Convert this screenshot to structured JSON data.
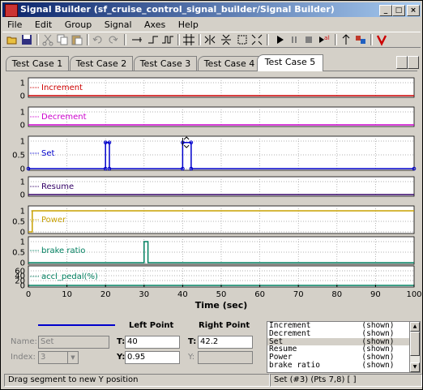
{
  "window": {
    "title": "Signal Builder (sf_cruise_control_signal_builder/Signal Builder)",
    "minimize": "_",
    "maximize": "□",
    "close": "×"
  },
  "menu": [
    "File",
    "Edit",
    "Group",
    "Signal",
    "Axes",
    "Help"
  ],
  "toolbar_icons": [
    "open-icon",
    "save-icon",
    "cut-icon",
    "copy-icon",
    "paste-icon",
    "undo-icon",
    "redo-icon",
    "step-right-icon",
    "step-up-icon",
    "pulse-icon",
    "grid-icon",
    "zoom-x-icon",
    "zoom-y-icon",
    "zoom-box-icon",
    "fit-icon",
    "play-icon",
    "pause-icon",
    "stop-icon",
    "record-icon",
    "toggle-icon",
    "simulink-icon",
    "verify-icon"
  ],
  "tabs": [
    "Test Case 1",
    "Test Case 2",
    "Test Case 3",
    "Test Case 4",
    "Test Case 5"
  ],
  "active_tab": "Test Case 5",
  "chart_data": {
    "type": "line",
    "xlabel": "Time (sec)",
    "xlim": [
      0,
      100
    ],
    "x_ticks": [
      "0",
      "10",
      "20",
      "30",
      "40",
      "50",
      "60",
      "70",
      "80",
      "90",
      "100"
    ],
    "grid": true,
    "series": [
      {
        "name": "Increment",
        "color": "#cc0000",
        "y_ticks": [
          "1",
          "0"
        ],
        "ylim": [
          0,
          1
        ],
        "points": [
          [
            0,
            0
          ],
          [
            100,
            0
          ]
        ]
      },
      {
        "name": "Decrement",
        "color": "#cc00cc",
        "y_ticks": [
          "1",
          "0"
        ],
        "ylim": [
          0,
          1
        ],
        "points": [
          [
            0,
            0
          ],
          [
            100,
            0
          ]
        ]
      },
      {
        "name": "Set",
        "color": "#0000cc",
        "y_ticks": [
          "1",
          "0.5",
          "0"
        ],
        "ylim": [
          0,
          1
        ],
        "points": [
          [
            0,
            0
          ],
          [
            20,
            0
          ],
          [
            20,
            0.95
          ],
          [
            21,
            0.95
          ],
          [
            21,
            0
          ],
          [
            40,
            0
          ],
          [
            40,
            0.95
          ],
          [
            42.2,
            0.95
          ],
          [
            42.2,
            0
          ],
          [
            100,
            0
          ]
        ]
      },
      {
        "name": "Resume",
        "color": "#330066",
        "y_ticks": [
          "1",
          "0"
        ],
        "ylim": [
          0,
          1
        ],
        "points": [
          [
            0,
            0
          ],
          [
            100,
            0
          ]
        ]
      },
      {
        "name": "Power",
        "color": "#c8a000",
        "y_ticks": [
          "1",
          "0.5",
          "0"
        ],
        "ylim": [
          0,
          1
        ],
        "points": [
          [
            0,
            0
          ],
          [
            1,
            0
          ],
          [
            1,
            1
          ],
          [
            100,
            1
          ]
        ]
      },
      {
        "name": "brake ratio",
        "color": "#008060",
        "y_ticks": [
          "1",
          "0.5",
          "0"
        ],
        "ylim": [
          0,
          1
        ],
        "points": [
          [
            0,
            0
          ],
          [
            30,
            0
          ],
          [
            30,
            1
          ],
          [
            31,
            1
          ],
          [
            31,
            0
          ],
          [
            100,
            0
          ]
        ]
      },
      {
        "name": "accl_pedal(%)",
        "color": "#008060",
        "y_ticks": [
          "60",
          "40",
          "20",
          "0"
        ],
        "ylim": [
          0,
          60
        ],
        "points": [
          [
            0,
            0
          ],
          [
            100,
            0
          ]
        ]
      }
    ]
  },
  "editor": {
    "left_point_label": "Left Point",
    "right_point_label": "Right Point",
    "name_label": "Name:",
    "name_value": "Set",
    "index_label": "Index:",
    "index_value": "3",
    "left_t_label": "T:",
    "left_t_value": "40",
    "left_y_label": "Y:",
    "left_y_value": "0.95",
    "right_t_label": "T:",
    "right_t_value": "42.2",
    "right_y_label": "Y:",
    "right_y_value": ""
  },
  "signal_list": [
    {
      "name": "Increment",
      "status": "(shown)"
    },
    {
      "name": "Decrement",
      "status": "(shown)"
    },
    {
      "name": "Set",
      "status": "(shown)"
    },
    {
      "name": "Resume",
      "status": "(shown)"
    },
    {
      "name": "Power",
      "status": "(shown)"
    },
    {
      "name": "brake ratio",
      "status": "(shown)"
    }
  ],
  "status": {
    "left": "Drag segment to new Y position",
    "right": "Set (#3) (Pts 7,8) [ ]"
  }
}
